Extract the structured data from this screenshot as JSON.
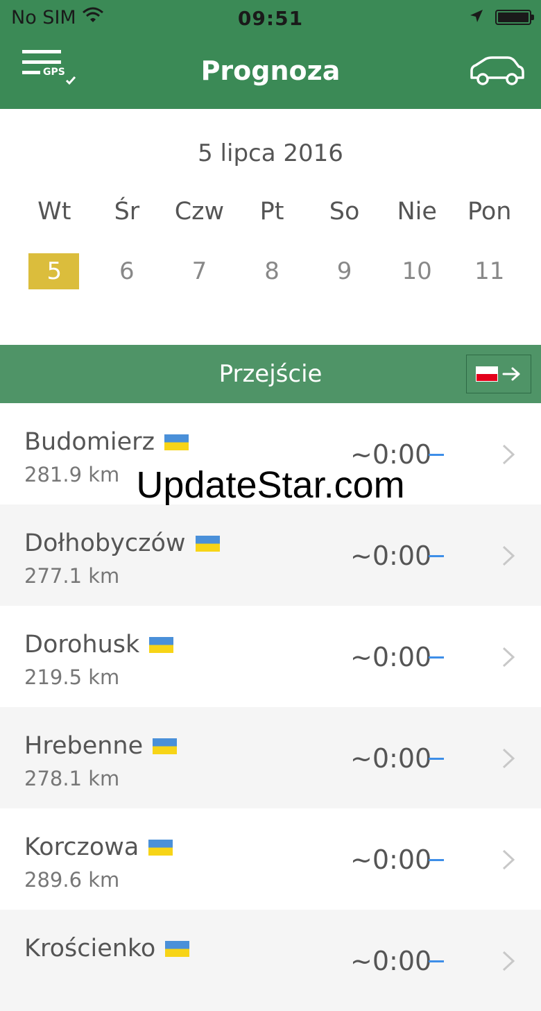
{
  "status_bar": {
    "carrier": "No SIM",
    "time": "09:51"
  },
  "nav": {
    "title": "Prognoza",
    "menu_badge": "GPS",
    "menu_icon": "gps-menu-icon",
    "car_icon": "car-icon"
  },
  "calendar": {
    "date_label": "5 lipca 2016",
    "weekdays": [
      "Wt",
      "Śr",
      "Czw",
      "Pt",
      "So",
      "Nie",
      "Pon"
    ],
    "days": [
      "5",
      "6",
      "7",
      "8",
      "9",
      "10",
      "11"
    ],
    "selected_day": "5",
    "selected_color": "#dbbd3c"
  },
  "section": {
    "label": "Przejście"
  },
  "crossings": [
    {
      "name": "Budomierz",
      "distance": "281.9 km",
      "wait": "~0:00"
    },
    {
      "name": "Dołhobyczów",
      "distance": "277.1 km",
      "wait": "~0:00"
    },
    {
      "name": "Dorohusk",
      "distance": "219.5 km",
      "wait": "~0:00"
    },
    {
      "name": "Hrebenne",
      "distance": "278.1 km",
      "wait": "~0:00"
    },
    {
      "name": "Korczowa",
      "distance": "289.6 km",
      "wait": "~0:00"
    },
    {
      "name": "Krościenko",
      "distance": "",
      "wait": "~0:00"
    }
  ],
  "colors": {
    "header": "#3b8a56",
    "section": "#4f9467",
    "trend": "#3d8ee8"
  },
  "watermark": "UpdateStar.com"
}
